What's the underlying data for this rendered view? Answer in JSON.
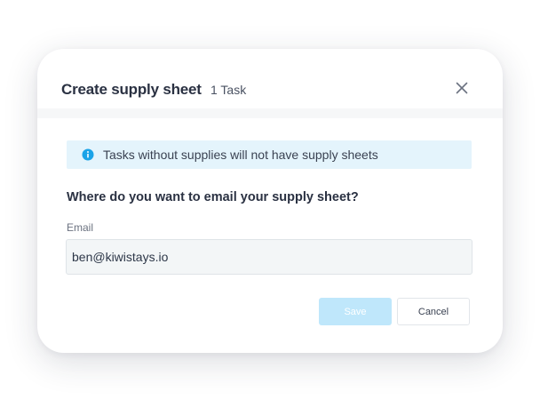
{
  "modal": {
    "title": "Create supply sheet",
    "subtitle": "1 Task",
    "close_icon": "close-icon"
  },
  "info_banner": {
    "icon": "info-icon",
    "text": "Tasks without supplies will not have supply sheets"
  },
  "form": {
    "question": "Where do you want to email your supply sheet?",
    "email_label": "Email",
    "email_value": "ben@kiwistays.io"
  },
  "actions": {
    "save_label": "Save",
    "cancel_label": "Cancel"
  },
  "colors": {
    "info_banner_bg": "#e4f4fc",
    "info_icon": "#1aa3e8",
    "save_disabled_bg": "#bfe7fb"
  }
}
